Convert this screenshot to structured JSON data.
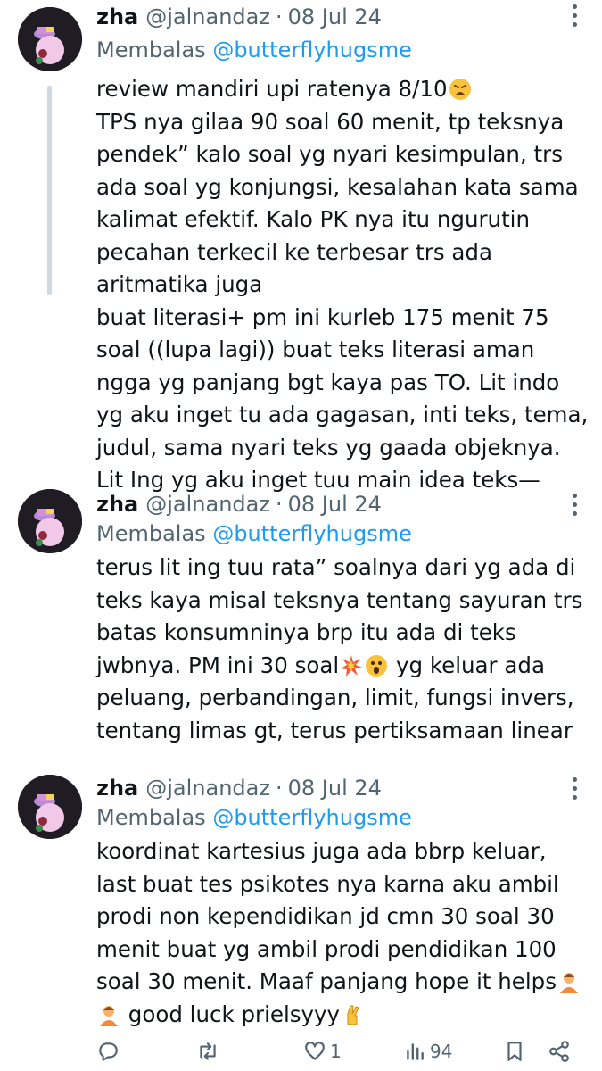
{
  "tweets": [
    {
      "name": "zha",
      "handle": "@jalnandaz",
      "separator": "·",
      "date": "08 Jul 24",
      "reply_prefix": "Membalas",
      "reply_to": "@butterflyhugsme",
      "text_a": "review mandiri upi ratenya 8/10",
      "text_b": "TPS nya gilaa 90 soal 60 menit, tp teksnya pendek” kalo soal yg nyari kesimpulan, trs ada soal yg konjungsi, kesalahan kata sama kalimat efektif. Kalo PK nya itu ngurutin pecahan terkecil ke terbesar trs ada aritmatika juga\nbuat literasi+ pm ini kurleb 175 menit 75 soal ((lupa lagi)) buat teks literasi aman ngga yg panjang bgt kaya pas TO. Lit indo yg aku inget tu ada gagasan, inti teks, tema, judul, sama nyari teks yg gaada objeknya. Lit Ing yg aku inget tuu main idea teks—"
    },
    {
      "name": "zha",
      "handle": "@jalnandaz",
      "separator": "·",
      "date": "08 Jul 24",
      "reply_prefix": "Membalas",
      "reply_to": "@butterflyhugsme",
      "text_a": "terus lit ing tuu rata” soalnya dari yg ada di teks kaya misal teksnya tentang sayuran trs batas konsumninya brp itu ada di teks jwbnya. PM ini 30 soal",
      "text_b": " yg keluar ada peluang, perbandingan, limit, fungsi invers, tentang limas gt, terus pertiksamaan linear"
    },
    {
      "name": "zha",
      "handle": "@jalnandaz",
      "separator": "·",
      "date": "08 Jul 24",
      "reply_prefix": "Membalas",
      "reply_to": "@butterflyhugsme",
      "text_a": "koordinat kartesius juga ada bbrp keluar, last buat tes psikotes nya karna aku ambil prodi non kependidikan jd cmn 30 soal 30 menit buat yg ambil prodi pendidikan 100 soal 30 menit. Maaf panjang hope it helps",
      "text_b": " good luck prielsyyy"
    }
  ],
  "actions": {
    "reply_icon": "reply-icon",
    "retweet_icon": "retweet-icon",
    "like_icon": "heart-icon",
    "like_count": "1",
    "views_icon": "views-icon",
    "views_count": "94",
    "bookmark_icon": "bookmark-icon",
    "share_icon": "share-icon"
  },
  "colors": {
    "text": "#0f1419",
    "muted": "#536471",
    "link": "#1d9bf0",
    "thread_line": "#cfd9de"
  }
}
